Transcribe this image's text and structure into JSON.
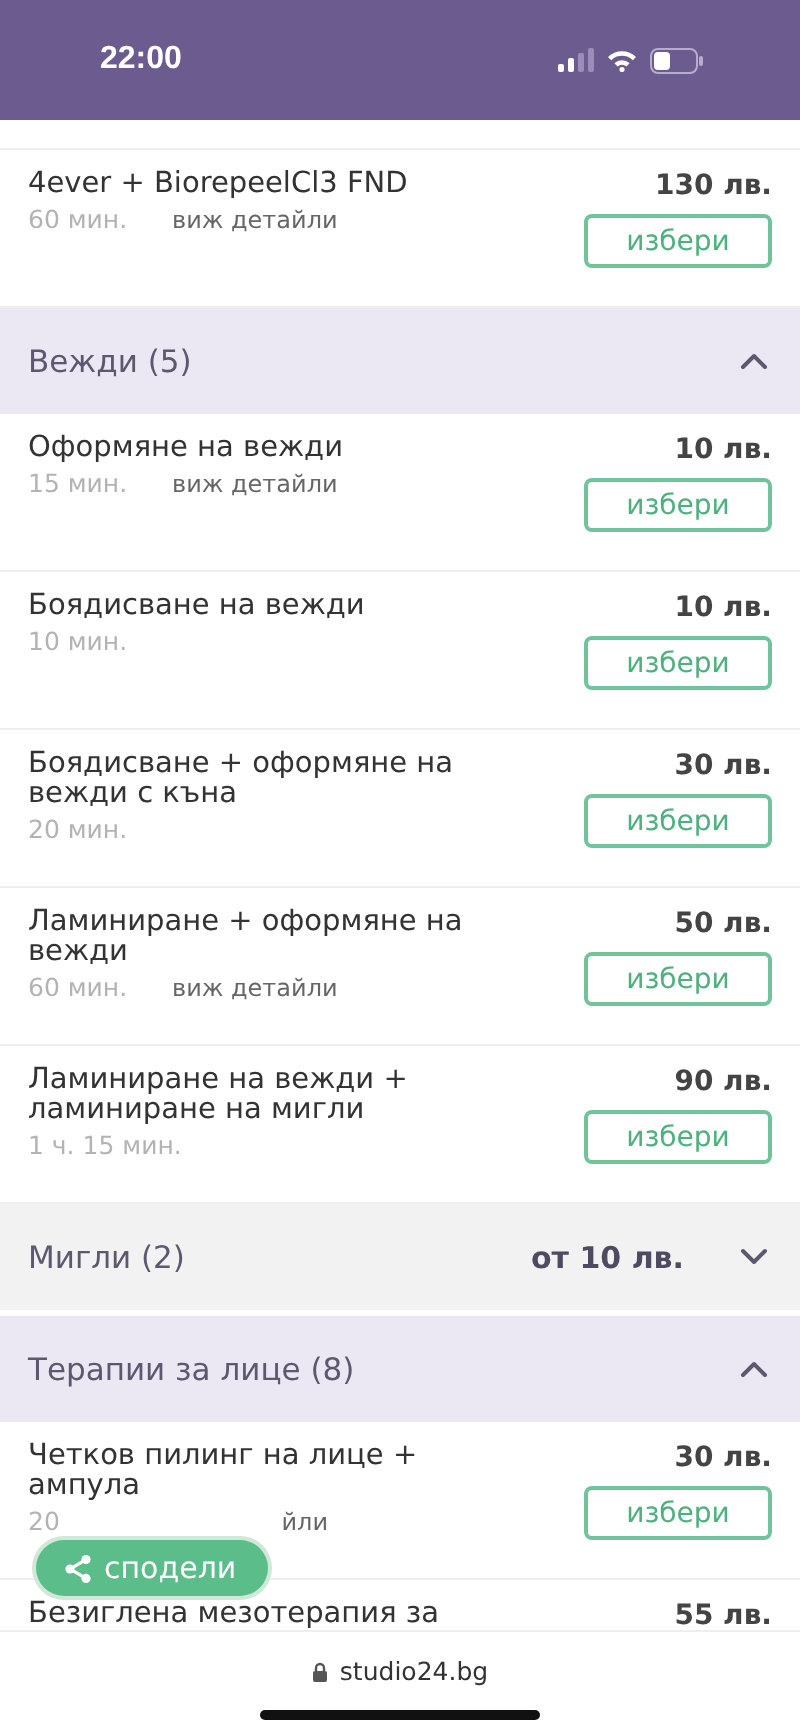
{
  "status_bar": {
    "time": "22:00"
  },
  "top_items": [
    {
      "name": "4ever + BiorepeelCl3 FND",
      "duration": "60 мин.",
      "details": "виж детайли",
      "price": "130 лв.",
      "button": "избери"
    }
  ],
  "categories": [
    {
      "title": "Вежди (5)",
      "expanded": true,
      "items": [
        {
          "name": "Оформяне на вежди",
          "duration": "15 мин.",
          "details": "виж детайли",
          "price": "10 лв.",
          "button": "избери"
        },
        {
          "name": "Боядисване на вежди",
          "duration": "10 мин.",
          "price": "10 лв.",
          "button": "избери"
        },
        {
          "name": "Боядисване + оформяне на вежди с къна",
          "duration": "20 мин.",
          "price": "30 лв.",
          "button": "избери"
        },
        {
          "name": "Ламиниране + оформяне на вежди",
          "duration": "60 мин.",
          "details": "виж детайли",
          "price": "50 лв.",
          "button": "избери"
        },
        {
          "name": "Ламиниране на вежди + ламиниране на мигли",
          "duration": "1 ч. 15 мин.",
          "price": "90 лв.",
          "button": "избери"
        }
      ]
    },
    {
      "title": "Мигли (2)",
      "expanded": false,
      "price_from": "от 10 лв."
    },
    {
      "title": "Терапии за лице (8)",
      "expanded": true,
      "items": [
        {
          "name": "Четков пилинг на лице + ампула",
          "duration": "20",
          "details": "йли",
          "price": "30 лв.",
          "button": "избери"
        },
        {
          "name": "Безиглена мезотерапия за",
          "price": "55 лв."
        }
      ]
    }
  ],
  "share_button": "сподели",
  "url_bar": {
    "url": "studio24.bg"
  }
}
